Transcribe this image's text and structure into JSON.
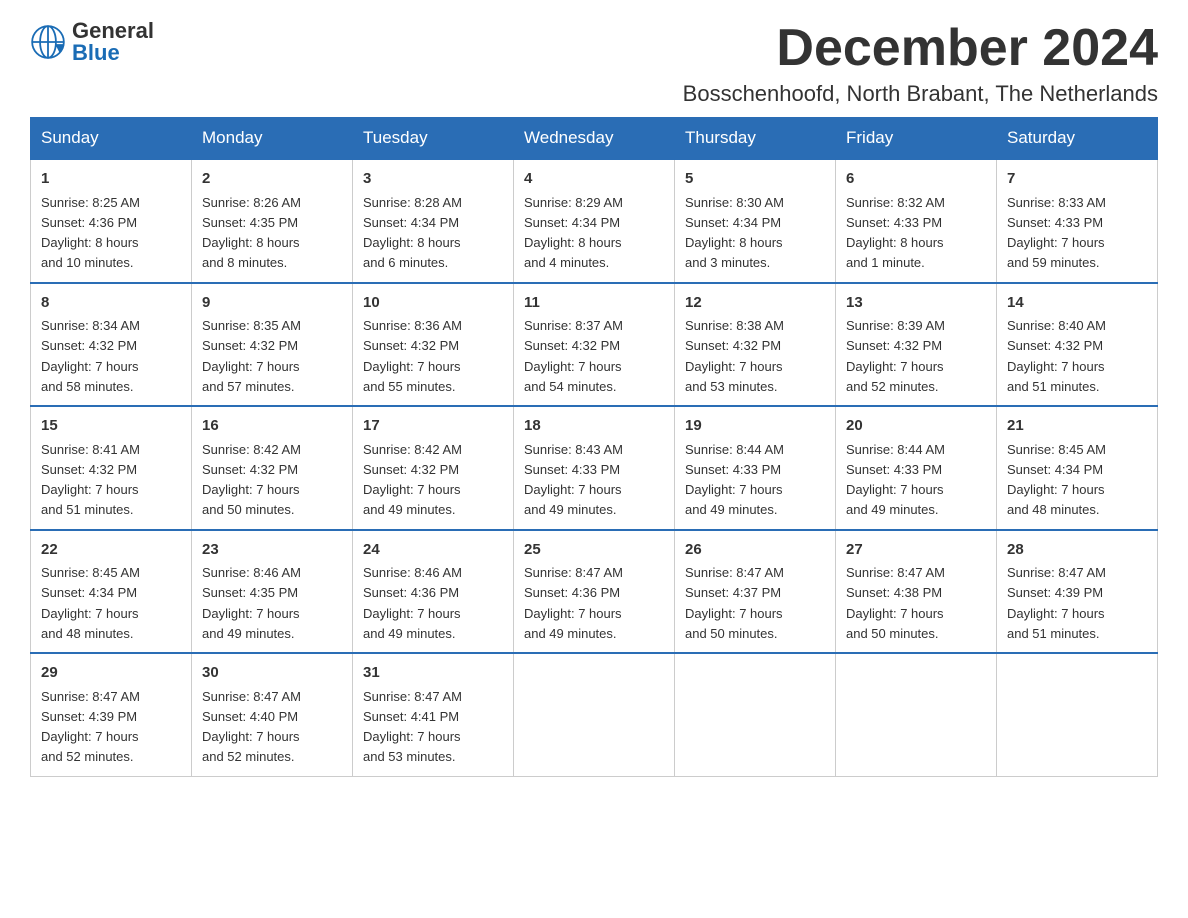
{
  "logo": {
    "text_general": "General",
    "text_blue": "Blue",
    "arrow_color": "#1a6cb5"
  },
  "header": {
    "title": "December 2024",
    "subtitle": "Bosschenhoofd, North Brabant, The Netherlands"
  },
  "weekdays": [
    "Sunday",
    "Monday",
    "Tuesday",
    "Wednesday",
    "Thursday",
    "Friday",
    "Saturday"
  ],
  "weeks": [
    [
      {
        "day": "1",
        "info": "Sunrise: 8:25 AM\nSunset: 4:36 PM\nDaylight: 8 hours\nand 10 minutes."
      },
      {
        "day": "2",
        "info": "Sunrise: 8:26 AM\nSunset: 4:35 PM\nDaylight: 8 hours\nand 8 minutes."
      },
      {
        "day": "3",
        "info": "Sunrise: 8:28 AM\nSunset: 4:34 PM\nDaylight: 8 hours\nand 6 minutes."
      },
      {
        "day": "4",
        "info": "Sunrise: 8:29 AM\nSunset: 4:34 PM\nDaylight: 8 hours\nand 4 minutes."
      },
      {
        "day": "5",
        "info": "Sunrise: 8:30 AM\nSunset: 4:34 PM\nDaylight: 8 hours\nand 3 minutes."
      },
      {
        "day": "6",
        "info": "Sunrise: 8:32 AM\nSunset: 4:33 PM\nDaylight: 8 hours\nand 1 minute."
      },
      {
        "day": "7",
        "info": "Sunrise: 8:33 AM\nSunset: 4:33 PM\nDaylight: 7 hours\nand 59 minutes."
      }
    ],
    [
      {
        "day": "8",
        "info": "Sunrise: 8:34 AM\nSunset: 4:32 PM\nDaylight: 7 hours\nand 58 minutes."
      },
      {
        "day": "9",
        "info": "Sunrise: 8:35 AM\nSunset: 4:32 PM\nDaylight: 7 hours\nand 57 minutes."
      },
      {
        "day": "10",
        "info": "Sunrise: 8:36 AM\nSunset: 4:32 PM\nDaylight: 7 hours\nand 55 minutes."
      },
      {
        "day": "11",
        "info": "Sunrise: 8:37 AM\nSunset: 4:32 PM\nDaylight: 7 hours\nand 54 minutes."
      },
      {
        "day": "12",
        "info": "Sunrise: 8:38 AM\nSunset: 4:32 PM\nDaylight: 7 hours\nand 53 minutes."
      },
      {
        "day": "13",
        "info": "Sunrise: 8:39 AM\nSunset: 4:32 PM\nDaylight: 7 hours\nand 52 minutes."
      },
      {
        "day": "14",
        "info": "Sunrise: 8:40 AM\nSunset: 4:32 PM\nDaylight: 7 hours\nand 51 minutes."
      }
    ],
    [
      {
        "day": "15",
        "info": "Sunrise: 8:41 AM\nSunset: 4:32 PM\nDaylight: 7 hours\nand 51 minutes."
      },
      {
        "day": "16",
        "info": "Sunrise: 8:42 AM\nSunset: 4:32 PM\nDaylight: 7 hours\nand 50 minutes."
      },
      {
        "day": "17",
        "info": "Sunrise: 8:42 AM\nSunset: 4:32 PM\nDaylight: 7 hours\nand 49 minutes."
      },
      {
        "day": "18",
        "info": "Sunrise: 8:43 AM\nSunset: 4:33 PM\nDaylight: 7 hours\nand 49 minutes."
      },
      {
        "day": "19",
        "info": "Sunrise: 8:44 AM\nSunset: 4:33 PM\nDaylight: 7 hours\nand 49 minutes."
      },
      {
        "day": "20",
        "info": "Sunrise: 8:44 AM\nSunset: 4:33 PM\nDaylight: 7 hours\nand 49 minutes."
      },
      {
        "day": "21",
        "info": "Sunrise: 8:45 AM\nSunset: 4:34 PM\nDaylight: 7 hours\nand 48 minutes."
      }
    ],
    [
      {
        "day": "22",
        "info": "Sunrise: 8:45 AM\nSunset: 4:34 PM\nDaylight: 7 hours\nand 48 minutes."
      },
      {
        "day": "23",
        "info": "Sunrise: 8:46 AM\nSunset: 4:35 PM\nDaylight: 7 hours\nand 49 minutes."
      },
      {
        "day": "24",
        "info": "Sunrise: 8:46 AM\nSunset: 4:36 PM\nDaylight: 7 hours\nand 49 minutes."
      },
      {
        "day": "25",
        "info": "Sunrise: 8:47 AM\nSunset: 4:36 PM\nDaylight: 7 hours\nand 49 minutes."
      },
      {
        "day": "26",
        "info": "Sunrise: 8:47 AM\nSunset: 4:37 PM\nDaylight: 7 hours\nand 50 minutes."
      },
      {
        "day": "27",
        "info": "Sunrise: 8:47 AM\nSunset: 4:38 PM\nDaylight: 7 hours\nand 50 minutes."
      },
      {
        "day": "28",
        "info": "Sunrise: 8:47 AM\nSunset: 4:39 PM\nDaylight: 7 hours\nand 51 minutes."
      }
    ],
    [
      {
        "day": "29",
        "info": "Sunrise: 8:47 AM\nSunset: 4:39 PM\nDaylight: 7 hours\nand 52 minutes."
      },
      {
        "day": "30",
        "info": "Sunrise: 8:47 AM\nSunset: 4:40 PM\nDaylight: 7 hours\nand 52 minutes."
      },
      {
        "day": "31",
        "info": "Sunrise: 8:47 AM\nSunset: 4:41 PM\nDaylight: 7 hours\nand 53 minutes."
      },
      null,
      null,
      null,
      null
    ]
  ]
}
